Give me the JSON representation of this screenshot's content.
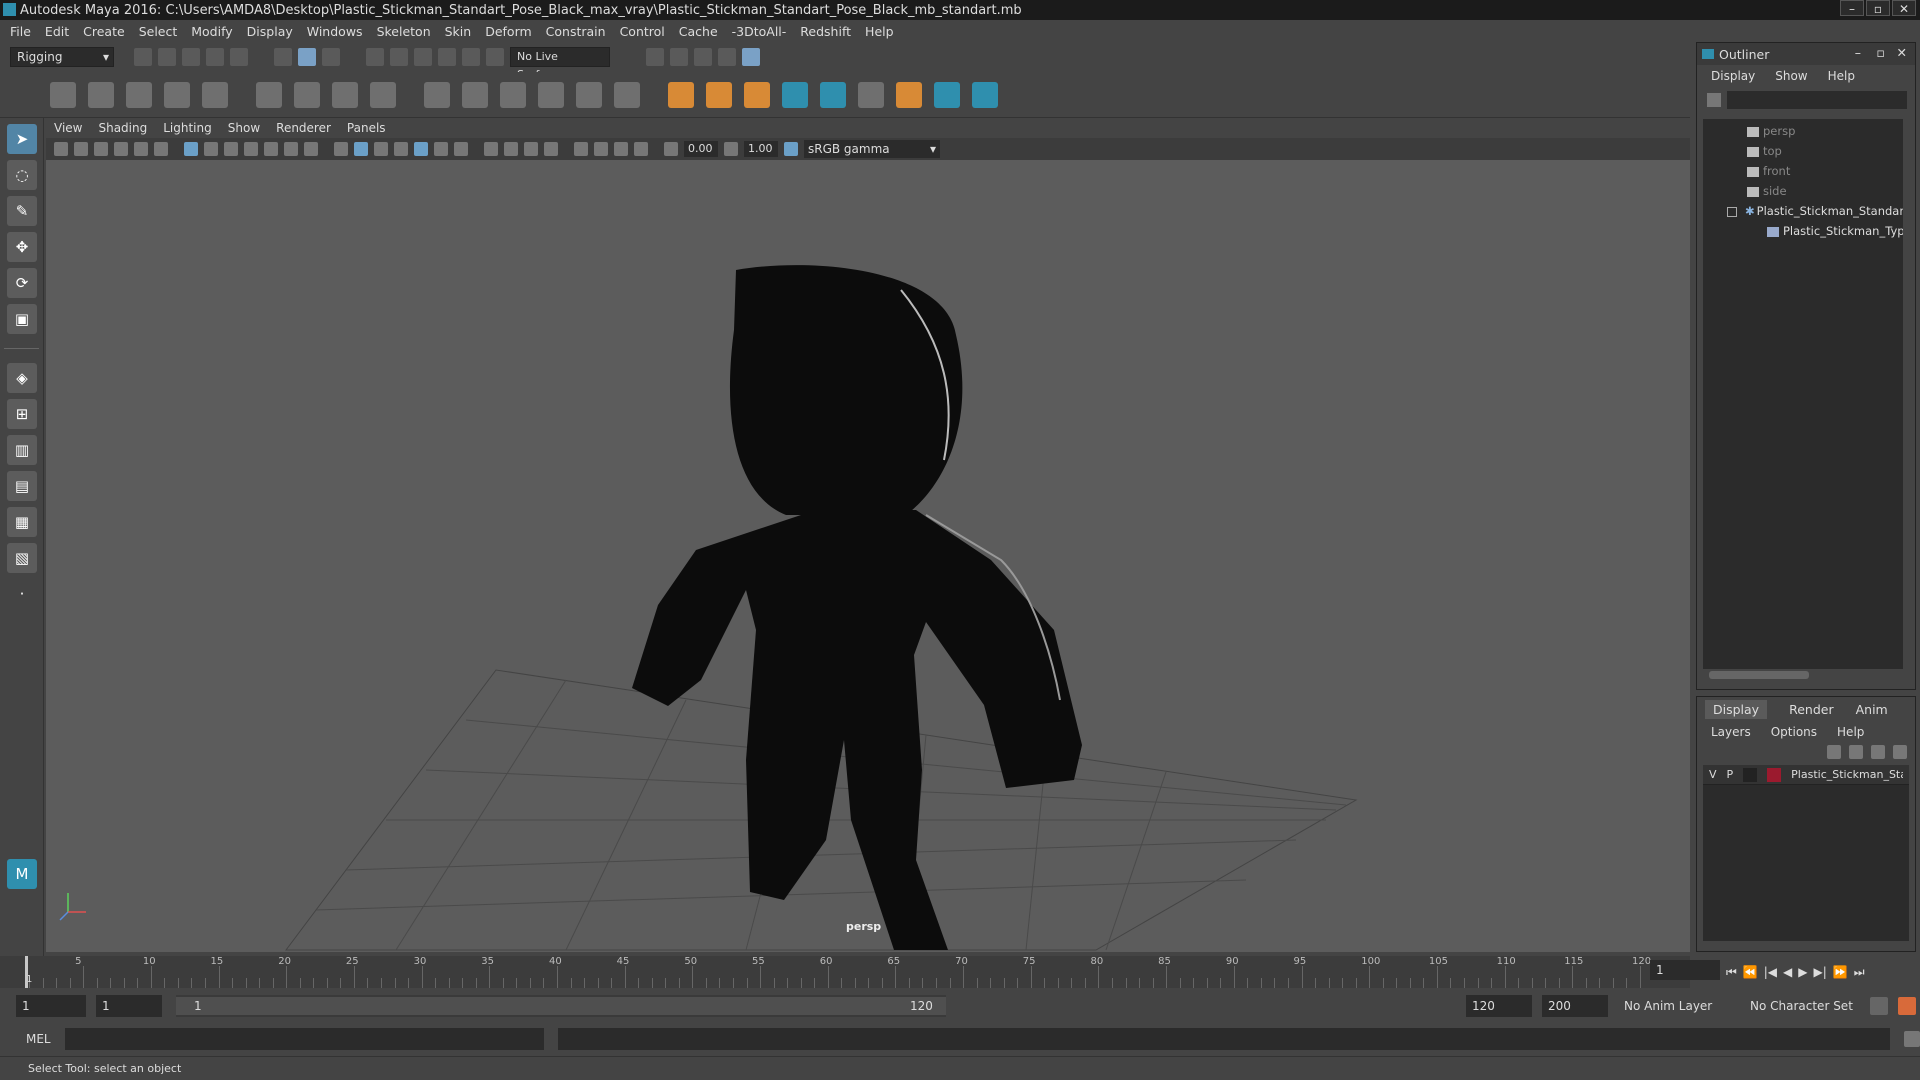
{
  "title": "Autodesk Maya 2016: C:\\Users\\AMDA8\\Desktop\\Plastic_Stickman_Standart_Pose_Black_max_vray\\Plastic_Stickman_Standart_Pose_Black_mb_standart.mb",
  "menus": [
    "File",
    "Edit",
    "Create",
    "Select",
    "Modify",
    "Display",
    "Windows",
    "Skeleton",
    "Skin",
    "Deform",
    "Constrain",
    "Control",
    "Cache",
    "-3DtoAll-",
    "Redshift",
    "Help"
  ],
  "mode": "Rigging",
  "live_surface": "No Live Surface",
  "panel_menus": [
    "View",
    "Shading",
    "Lighting",
    "Show",
    "Renderer",
    "Panels"
  ],
  "viewport": {
    "exposure": "0.00",
    "gamma_value": "1.00",
    "color_space": "sRGB gamma",
    "camera_label": "persp"
  },
  "timeline": {
    "ticks": [
      "5",
      "10",
      "15",
      "20",
      "25",
      "30",
      "35",
      "40",
      "45",
      "50",
      "55",
      "60",
      "65",
      "70",
      "75",
      "80",
      "85",
      "90",
      "95",
      "100",
      "105",
      "110",
      "115",
      "120"
    ],
    "first_tick": "1",
    "current_frame": "1"
  },
  "range": {
    "start": "1",
    "playback_start": "1",
    "slider_start": "1",
    "slider_end": "120",
    "playback_end": "120",
    "end": "200",
    "anim_layer": "No Anim Layer",
    "character_set": "No Character Set"
  },
  "command": {
    "label": "MEL"
  },
  "status": "Select Tool: select an object",
  "outliner": {
    "title": "Outliner",
    "menus": [
      "Display",
      "Show",
      "Help"
    ],
    "items": [
      {
        "label": "persp",
        "state": "dim"
      },
      {
        "label": "top",
        "state": "dim"
      },
      {
        "label": "front",
        "state": "dim"
      },
      {
        "label": "side",
        "state": "dim"
      },
      {
        "label": "Plastic_Stickman_Standart",
        "state": "normal"
      },
      {
        "label": "Plastic_Stickman_Type",
        "state": "normal"
      }
    ]
  },
  "layers": {
    "tabs": [
      "Display",
      "Render",
      "Anim"
    ],
    "menus": [
      "Layers",
      "Options",
      "Help"
    ],
    "row": {
      "v": "V",
      "p": "P",
      "name": "Plastic_Stickman_Standart",
      "color": "#9b1a2e"
    }
  },
  "colors": {
    "accent": "#5285a6",
    "maya_teal": "#2f8fae"
  }
}
